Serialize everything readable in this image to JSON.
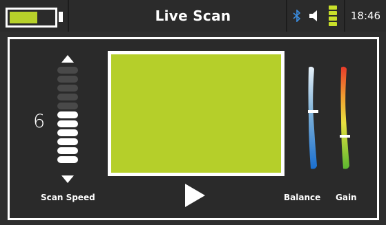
{
  "status_bar": {
    "title": "Live Scan",
    "time": "18:46",
    "battery_level": 0.64,
    "icons": [
      "battery-icon",
      "bluetooth-icon",
      "speaker-icon",
      "signal-icon"
    ],
    "accent_color": "#b7d12a"
  },
  "scan_speed": {
    "label": "Scan Speed",
    "value": "6",
    "level": 6,
    "max_level": 11
  },
  "display": {
    "color": "#b5cf2a"
  },
  "balance": {
    "label": "Balance",
    "level": 0.58
  },
  "gain": {
    "label": "Gain",
    "level": 0.33
  }
}
